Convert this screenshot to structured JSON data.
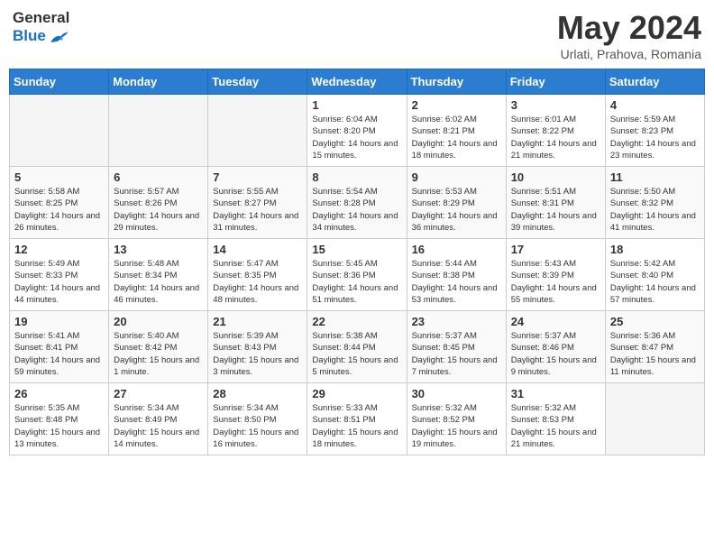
{
  "header": {
    "logo_general": "General",
    "logo_blue": "Blue",
    "month_title": "May 2024",
    "subtitle": "Urlati, Prahova, Romania"
  },
  "days_of_week": [
    "Sunday",
    "Monday",
    "Tuesday",
    "Wednesday",
    "Thursday",
    "Friday",
    "Saturday"
  ],
  "weeks": [
    [
      {
        "day": "",
        "info": ""
      },
      {
        "day": "",
        "info": ""
      },
      {
        "day": "",
        "info": ""
      },
      {
        "day": "1",
        "info": "Sunrise: 6:04 AM\nSunset: 8:20 PM\nDaylight: 14 hours\nand 15 minutes."
      },
      {
        "day": "2",
        "info": "Sunrise: 6:02 AM\nSunset: 8:21 PM\nDaylight: 14 hours\nand 18 minutes."
      },
      {
        "day": "3",
        "info": "Sunrise: 6:01 AM\nSunset: 8:22 PM\nDaylight: 14 hours\nand 21 minutes."
      },
      {
        "day": "4",
        "info": "Sunrise: 5:59 AM\nSunset: 8:23 PM\nDaylight: 14 hours\nand 23 minutes."
      }
    ],
    [
      {
        "day": "5",
        "info": "Sunrise: 5:58 AM\nSunset: 8:25 PM\nDaylight: 14 hours\nand 26 minutes."
      },
      {
        "day": "6",
        "info": "Sunrise: 5:57 AM\nSunset: 8:26 PM\nDaylight: 14 hours\nand 29 minutes."
      },
      {
        "day": "7",
        "info": "Sunrise: 5:55 AM\nSunset: 8:27 PM\nDaylight: 14 hours\nand 31 minutes."
      },
      {
        "day": "8",
        "info": "Sunrise: 5:54 AM\nSunset: 8:28 PM\nDaylight: 14 hours\nand 34 minutes."
      },
      {
        "day": "9",
        "info": "Sunrise: 5:53 AM\nSunset: 8:29 PM\nDaylight: 14 hours\nand 36 minutes."
      },
      {
        "day": "10",
        "info": "Sunrise: 5:51 AM\nSunset: 8:31 PM\nDaylight: 14 hours\nand 39 minutes."
      },
      {
        "day": "11",
        "info": "Sunrise: 5:50 AM\nSunset: 8:32 PM\nDaylight: 14 hours\nand 41 minutes."
      }
    ],
    [
      {
        "day": "12",
        "info": "Sunrise: 5:49 AM\nSunset: 8:33 PM\nDaylight: 14 hours\nand 44 minutes."
      },
      {
        "day": "13",
        "info": "Sunrise: 5:48 AM\nSunset: 8:34 PM\nDaylight: 14 hours\nand 46 minutes."
      },
      {
        "day": "14",
        "info": "Sunrise: 5:47 AM\nSunset: 8:35 PM\nDaylight: 14 hours\nand 48 minutes."
      },
      {
        "day": "15",
        "info": "Sunrise: 5:45 AM\nSunset: 8:36 PM\nDaylight: 14 hours\nand 51 minutes."
      },
      {
        "day": "16",
        "info": "Sunrise: 5:44 AM\nSunset: 8:38 PM\nDaylight: 14 hours\nand 53 minutes."
      },
      {
        "day": "17",
        "info": "Sunrise: 5:43 AM\nSunset: 8:39 PM\nDaylight: 14 hours\nand 55 minutes."
      },
      {
        "day": "18",
        "info": "Sunrise: 5:42 AM\nSunset: 8:40 PM\nDaylight: 14 hours\nand 57 minutes."
      }
    ],
    [
      {
        "day": "19",
        "info": "Sunrise: 5:41 AM\nSunset: 8:41 PM\nDaylight: 14 hours\nand 59 minutes."
      },
      {
        "day": "20",
        "info": "Sunrise: 5:40 AM\nSunset: 8:42 PM\nDaylight: 15 hours\nand 1 minute."
      },
      {
        "day": "21",
        "info": "Sunrise: 5:39 AM\nSunset: 8:43 PM\nDaylight: 15 hours\nand 3 minutes."
      },
      {
        "day": "22",
        "info": "Sunrise: 5:38 AM\nSunset: 8:44 PM\nDaylight: 15 hours\nand 5 minutes."
      },
      {
        "day": "23",
        "info": "Sunrise: 5:37 AM\nSunset: 8:45 PM\nDaylight: 15 hours\nand 7 minutes."
      },
      {
        "day": "24",
        "info": "Sunrise: 5:37 AM\nSunset: 8:46 PM\nDaylight: 15 hours\nand 9 minutes."
      },
      {
        "day": "25",
        "info": "Sunrise: 5:36 AM\nSunset: 8:47 PM\nDaylight: 15 hours\nand 11 minutes."
      }
    ],
    [
      {
        "day": "26",
        "info": "Sunrise: 5:35 AM\nSunset: 8:48 PM\nDaylight: 15 hours\nand 13 minutes."
      },
      {
        "day": "27",
        "info": "Sunrise: 5:34 AM\nSunset: 8:49 PM\nDaylight: 15 hours\nand 14 minutes."
      },
      {
        "day": "28",
        "info": "Sunrise: 5:34 AM\nSunset: 8:50 PM\nDaylight: 15 hours\nand 16 minutes."
      },
      {
        "day": "29",
        "info": "Sunrise: 5:33 AM\nSunset: 8:51 PM\nDaylight: 15 hours\nand 18 minutes."
      },
      {
        "day": "30",
        "info": "Sunrise: 5:32 AM\nSunset: 8:52 PM\nDaylight: 15 hours\nand 19 minutes."
      },
      {
        "day": "31",
        "info": "Sunrise: 5:32 AM\nSunset: 8:53 PM\nDaylight: 15 hours\nand 21 minutes."
      },
      {
        "day": "",
        "info": ""
      }
    ]
  ]
}
